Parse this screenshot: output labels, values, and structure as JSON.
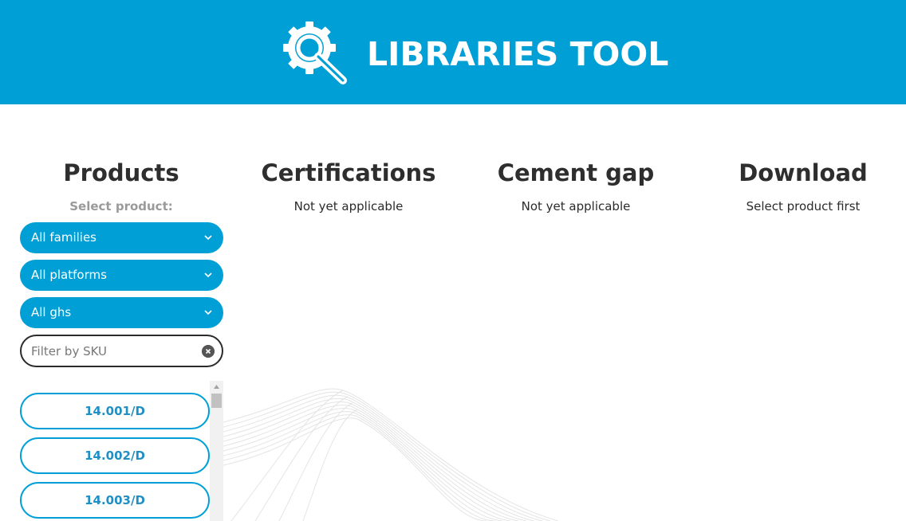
{
  "header": {
    "title": "LIBRARIES TOOL",
    "logo_icon": "gear-magnifier-icon",
    "background": "#009fd6"
  },
  "columns": {
    "products": {
      "title": "Products",
      "subtitle": "Select product:"
    },
    "certifications": {
      "title": "Certifications",
      "subtitle": "Not yet applicable"
    },
    "cement_gap": {
      "title": "Cement gap",
      "subtitle": "Not yet applicable"
    },
    "download": {
      "title": "Download",
      "subtitle": "Select product first"
    }
  },
  "filters": {
    "families": "All families",
    "platforms": "All platforms",
    "ghs": "All ghs",
    "sku_placeholder": "Filter by SKU",
    "sku_value": ""
  },
  "products": {
    "items": [
      "14.001/D",
      "14.002/D",
      "14.003/D"
    ]
  },
  "colors": {
    "accent": "#009fd6",
    "sku_text": "#1f8fc4"
  }
}
